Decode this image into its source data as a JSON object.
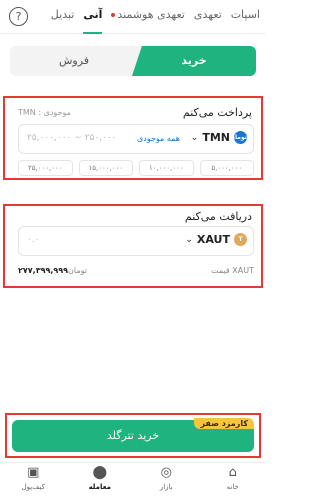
{
  "header": {
    "tabs": [
      {
        "label": "اسپات"
      },
      {
        "label": "تعهدی"
      },
      {
        "label": "تعهدی هوشمند"
      },
      {
        "label": "آنی"
      },
      {
        "label": "تبدیل"
      }
    ],
    "help_icon": "help-circle-icon",
    "help_glyph": "?"
  },
  "toggle": {
    "buy_label": "خرید",
    "sell_label": "فروش"
  },
  "pay": {
    "title": "پرداخت می‌کنم",
    "balance_label": "موجودی :",
    "balance_value": "TMN",
    "currency": "TMN",
    "currency_badge": "تومان",
    "all_balance": "همه موجودی",
    "range_text": "۲۵,۰۰۰,۰۰۰ ~ ۲۵۰,۰۰۰",
    "chips": [
      "۲۵,۰۰۰,۰۰۰",
      "۱۵,۰۰۰,۰۰۰",
      "۱۰,۰۰۰,۰۰۰",
      "۵,۰۰۰,۰۰۰"
    ]
  },
  "receive": {
    "title": "دریافت می‌کنم",
    "currency": "XAUT",
    "placeholder": "۰.۰",
    "price_label": "قیمت XAUT",
    "price_value": "۲۷۷,۳۹۹,۹۹۹",
    "price_unit": "تومان"
  },
  "action": {
    "buy_button": "خرید تترگلد",
    "fee_badge": "کارمزد صفر"
  },
  "bottom_nav": [
    {
      "label": "خانه",
      "icon": "home-icon"
    },
    {
      "label": "بازار",
      "icon": "market-icon"
    },
    {
      "label": "معامله",
      "icon": "trade-icon"
    },
    {
      "label": "کیف‌پول",
      "icon": "wallet-icon"
    }
  ],
  "colors": {
    "accent": "#1fb37f",
    "highlight": "#e53935",
    "fee": "#f5c542"
  }
}
